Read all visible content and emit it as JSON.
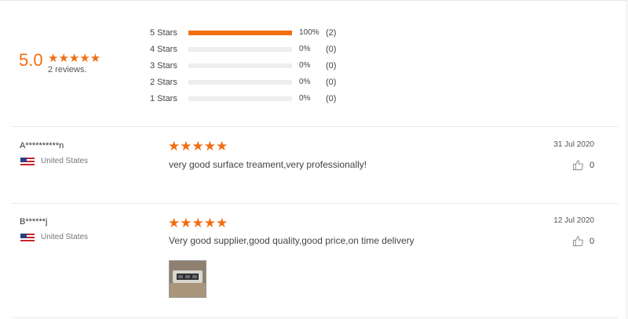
{
  "summary": {
    "score": "5.0",
    "stars": "★★★★★",
    "review_count": "2 reviews.",
    "distribution": [
      {
        "label": "5 Stars",
        "percent": "100%",
        "count": "(2)",
        "fill": 1.0
      },
      {
        "label": "4 Stars",
        "percent": "0%",
        "count": "(0)",
        "fill": 0
      },
      {
        "label": "3 Stars",
        "percent": "0%",
        "count": "(0)",
        "fill": 0
      },
      {
        "label": "2 Stars",
        "percent": "0%",
        "count": "(0)",
        "fill": 0
      },
      {
        "label": "1 Stars",
        "percent": "0%",
        "count": "(0)",
        "fill": 0
      }
    ]
  },
  "reviews": [
    {
      "reviewer": "A**********n",
      "country": "United States",
      "stars": "★★★★★",
      "comment": "very good surface treament,very professionally!",
      "date": "31 Jul 2020",
      "likes": "0"
    },
    {
      "reviewer": "B******j",
      "country": "United States",
      "stars": "★★★★★",
      "comment": "Very good supplier,good quality,good price,on time delivery",
      "date": "12 Jul 2020",
      "likes": "0"
    }
  ],
  "colors": {
    "accent": "#f26e11",
    "track": "#eeeeee",
    "divider": "#e6e6e6"
  },
  "icons": [
    "star-icon",
    "us-flag-icon",
    "thumbs-up-icon"
  ]
}
